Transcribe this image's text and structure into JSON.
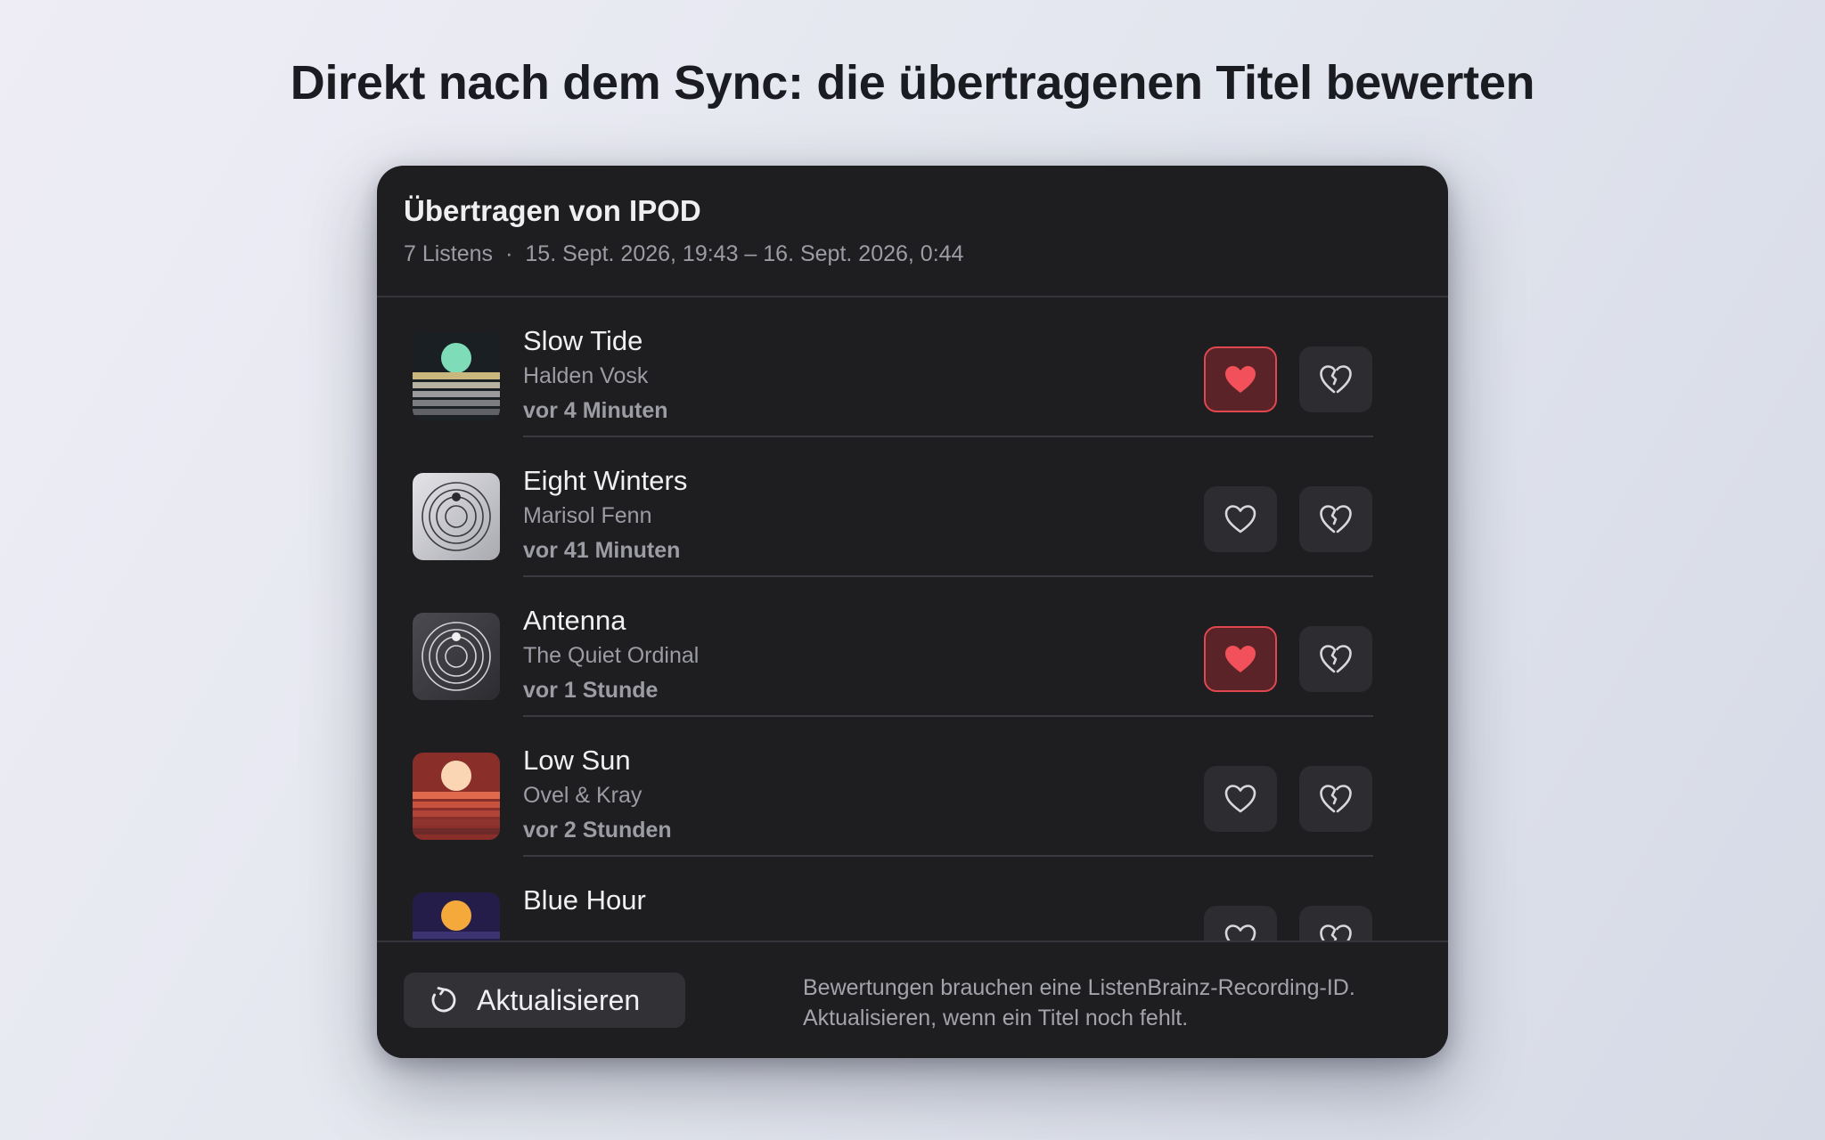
{
  "headline": "Direkt nach dem Sync: die übertragenen Titel bewerten",
  "panel": {
    "title": "Übertragen von IPOD",
    "listen_count": "7 Listens",
    "separator": "·",
    "date_range": "15. Sept. 2026, 19:43 – 16. Sept. 2026, 0:44"
  },
  "tracks": [
    {
      "title": "Slow Tide",
      "artist": "Halden Vosk",
      "time": "vor 4 Minuten",
      "loved": true,
      "artwork": "sunset-stripes-teal-icon"
    },
    {
      "title": "Eight Winters",
      "artist": "Marisol Fenn",
      "time": "vor 41 Minuten",
      "loved": false,
      "artwork": "concentric-rings-light-icon"
    },
    {
      "title": "Antenna",
      "artist": "The Quiet Ordinal",
      "time": "vor 1 Stunde",
      "loved": true,
      "artwork": "concentric-rings-dark-icon"
    },
    {
      "title": "Low Sun",
      "artist": "Ovel & Kray",
      "time": "vor 2 Stunden",
      "loved": false,
      "artwork": "sunset-stripes-red-icon"
    },
    {
      "title": "Blue Hour",
      "artist": "",
      "time": "",
      "loved": false,
      "artwork": "sunset-stripes-navy-icon"
    }
  ],
  "footer": {
    "refresh_label": "Aktualisieren",
    "note_line1": "Bewertungen brauchen eine ListenBrainz-Recording-ID.",
    "note_line2": "Aktualisieren, wenn ein Titel noch fehlt."
  },
  "colors": {
    "love_active_bg": "#5a2328",
    "love_active_border": "#e0474f",
    "heart_fill": "#f2505a",
    "panel_bg": "#1e1e21"
  }
}
